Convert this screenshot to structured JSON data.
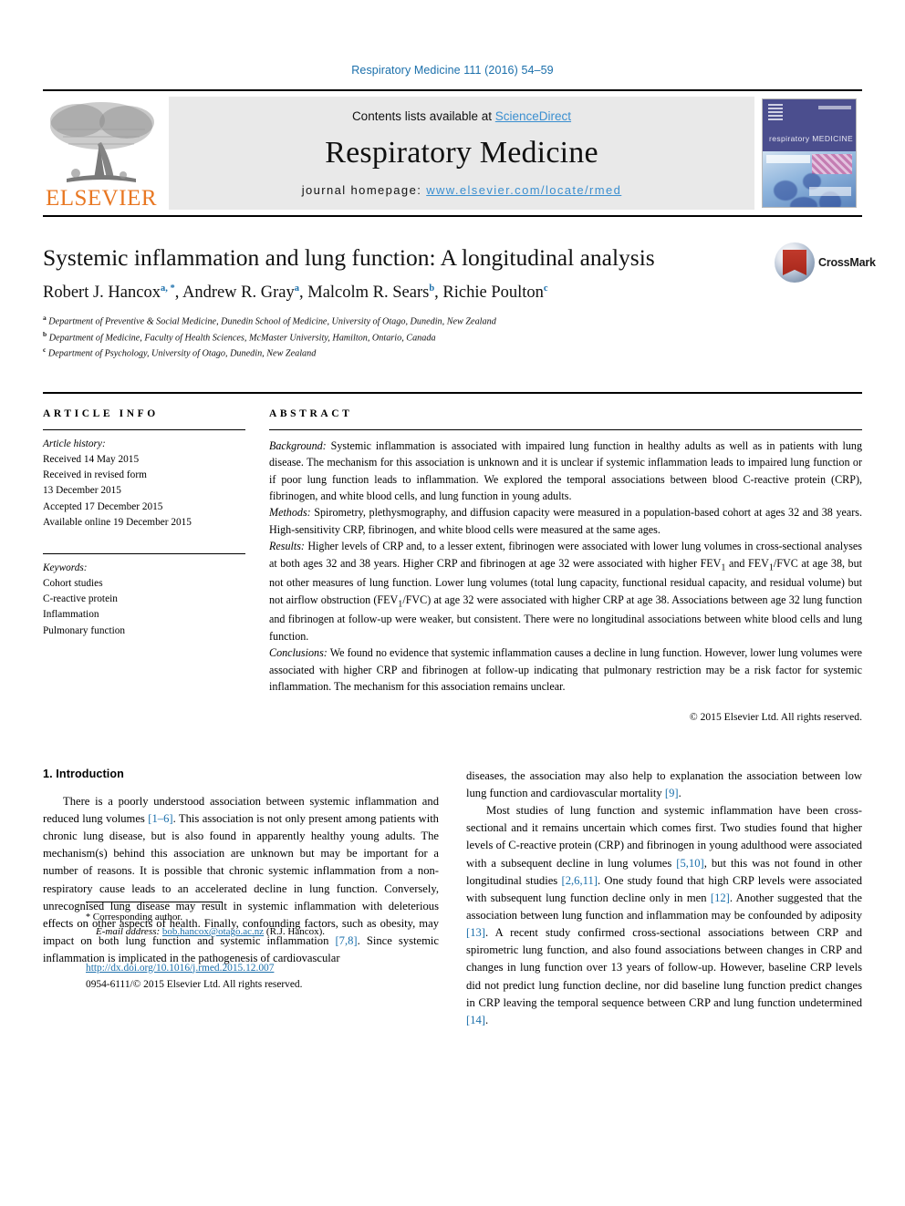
{
  "running_head": "Respiratory Medicine 111 (2016) 54–59",
  "masthead": {
    "publisher_name": "ELSEVIER",
    "contents_prefix": "Contents lists available at ",
    "contents_link": "ScienceDirect",
    "journal_title": "Respiratory Medicine",
    "homepage_label": "journal homepage: ",
    "homepage_url": "www.elsevier.com/locate/rmed",
    "cover_journal_name": "respiratory MEDICINE"
  },
  "title_block": {
    "title": "Systemic inflammation and lung function: A longitudinal analysis",
    "crossmark_label": "CrossMark",
    "authors": [
      {
        "name": "Robert J. Hancox",
        "marks": "a, *"
      },
      {
        "name": "Andrew R. Gray",
        "marks": "a"
      },
      {
        "name": "Malcolm R. Sears",
        "marks": "b"
      },
      {
        "name": "Richie Poulton",
        "marks": "c"
      }
    ],
    "affiliations": [
      {
        "mark": "a",
        "text": "Department of Preventive & Social Medicine, Dunedin School of Medicine, University of Otago, Dunedin, New Zealand"
      },
      {
        "mark": "b",
        "text": "Department of Medicine, Faculty of Health Sciences, McMaster University, Hamilton, Ontario, Canada"
      },
      {
        "mark": "c",
        "text": "Department of Psychology, University of Otago, Dunedin, New Zealand"
      }
    ]
  },
  "article_info": {
    "heading": "ARTICLE INFO",
    "history_label": "Article history:",
    "history": [
      "Received 14 May 2015",
      "Received in revised form",
      "13 December 2015",
      "Accepted 17 December 2015",
      "Available online 19 December 2015"
    ],
    "keywords_label": "Keywords:",
    "keywords": [
      "Cohort studies",
      "C-reactive protein",
      "Inflammation",
      "Pulmonary function"
    ]
  },
  "abstract": {
    "heading": "ABSTRACT",
    "background_label": "Background:",
    "background_text": " Systemic inflammation is associated with impaired lung function in healthy adults as well as in patients with lung disease. The mechanism for this association is unknown and it is unclear if systemic inflammation leads to impaired lung function or if poor lung function leads to inflammation. We explored the temporal associations between blood C-reactive protein (CRP), fibrinogen, and white blood cells, and lung function in young adults.",
    "methods_label": "Methods:",
    "methods_text": " Spirometry, plethysmography, and diffusion capacity were measured in a population-based cohort at ages 32 and 38 years. High-sensitivity CRP, fibrinogen, and white blood cells were measured at the same ages.",
    "results_label": "Results:",
    "results_text_1": " Higher levels of CRP and, to a lesser extent, fibrinogen were associated with lower lung volumes in cross-sectional analyses at both ages 32 and 38 years. Higher CRP and fibrinogen at age 32 were associated with higher FEV",
    "results_text_2": " and FEV",
    "results_text_3": "/FVC at age 38, but not other measures of lung function. Lower lung volumes (total lung capacity, functional residual capacity, and residual volume) but not airflow obstruction (FEV",
    "results_text_4": "/FVC) at age 32 were associated with higher CRP at age 38. Associations between age 32 lung function and fibrinogen at follow-up were weaker, but consistent. There were no longitudinal associations between white blood cells and lung function.",
    "subscript_1": "1",
    "conclusions_label": "Conclusions:",
    "conclusions_text": " We found no evidence that systemic inflammation causes a decline in lung function. However, lower lung volumes were associated with higher CRP and fibrinogen at follow-up indicating that pulmonary restriction may be a risk factor for systemic inflammation. The mechanism for this association remains unclear.",
    "copyright": "© 2015 Elsevier Ltd. All rights reserved."
  },
  "introduction": {
    "heading": "1. Introduction",
    "left_p1_a": "There is a poorly understood association between systemic inflammation and reduced lung volumes ",
    "left_p1_ref1": "[1–6]",
    "left_p1_b": ". This association is not only present among patients with chronic lung disease, but is also found in apparently healthy young adults. The mechanism(s) behind this association are unknown but may be important for a number of reasons. It is possible that chronic systemic inflammation from a non-respiratory cause leads to an accelerated decline in lung function. Conversely, unrecognised lung disease may result in systemic inflammation with deleterious effects on other aspects of health. Finally, confounding factors, such as obesity, may impact on both lung function and systemic inflammation ",
    "left_p1_ref2": "[7,8]",
    "left_p1_c": ". Since systemic inflammation is implicated in the pathogenesis of cardiovascular",
    "right_p1_cont_a": "diseases, the association may also help to explanation the association between low lung function and cardiovascular mortality ",
    "right_p1_ref": "[9]",
    "right_p1_cont_b": ".",
    "right_p2_a": "Most studies of lung function and systemic inflammation have been cross-sectional and it remains uncertain which comes first. Two studies found that higher levels of C-reactive protein (CRP) and fibrinogen in young adulthood were associated with a subsequent decline in lung volumes ",
    "right_p2_ref1": "[5,10]",
    "right_p2_b": ", but this was not found in other longitudinal studies ",
    "right_p2_ref2": "[2,6,11]",
    "right_p2_c": ". One study found that high CRP levels were associated with subsequent lung function decline only in men ",
    "right_p2_ref3": "[12]",
    "right_p2_d": ". Another suggested that the association between lung function and inflammation may be confounded by adiposity ",
    "right_p2_ref4": "[13]",
    "right_p2_e": ". A recent study confirmed cross-sectional associations between CRP and spirometric lung function, and also found associations between changes in CRP and changes in lung function over 13 years of follow-up. However, baseline CRP levels did not predict lung function decline, nor did baseline lung function predict changes in CRP leaving the temporal sequence between CRP and lung function undetermined ",
    "right_p2_ref5": "[14]",
    "right_p2_f": "."
  },
  "footnotes": {
    "corresponding_star": "*",
    "corresponding_label": " Corresponding author.",
    "email_label": "E-mail address:",
    "email": "bob.hancox@otago.ac.nz",
    "email_suffix": " (R.J. Hancox).",
    "doi": "http://dx.doi.org/10.1016/j.rmed.2015.12.007",
    "issn_line_a": "0954-6111/© 2015 Elsevier Ltd. All rights reserved."
  },
  "colors": {
    "link_blue": "#1a6fab",
    "elsevier_orange": "#e87722",
    "masthead_grey": "#e9e9e9"
  }
}
